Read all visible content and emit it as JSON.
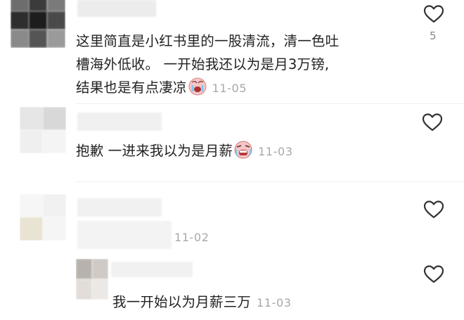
{
  "comments": [
    {
      "text_lines": [
        "这里简直是小红书里的一股清流，清一色吐",
        "槽海外低收。 一开始我还以为是月3万镑,",
        "结果也是有点凄凉"
      ],
      "date": "11-05",
      "likes": "5",
      "emoji": "crying-face-emoji"
    },
    {
      "text_lines": [
        "抱歉 一进来我以为是月薪"
      ],
      "date": "11-03",
      "emoji": "weeping-face-emoji"
    },
    {
      "text_lines": [
        ""
      ],
      "date": "11-02"
    }
  ],
  "reply": {
    "text": "我一开始以为月薪三万",
    "date": "11-03"
  },
  "colors": {
    "text": "#222222",
    "date": "#a8a8a8",
    "heart_outline": "#333333",
    "count": "#8a8a8a"
  },
  "icons": [
    "heart-outline-icon"
  ]
}
